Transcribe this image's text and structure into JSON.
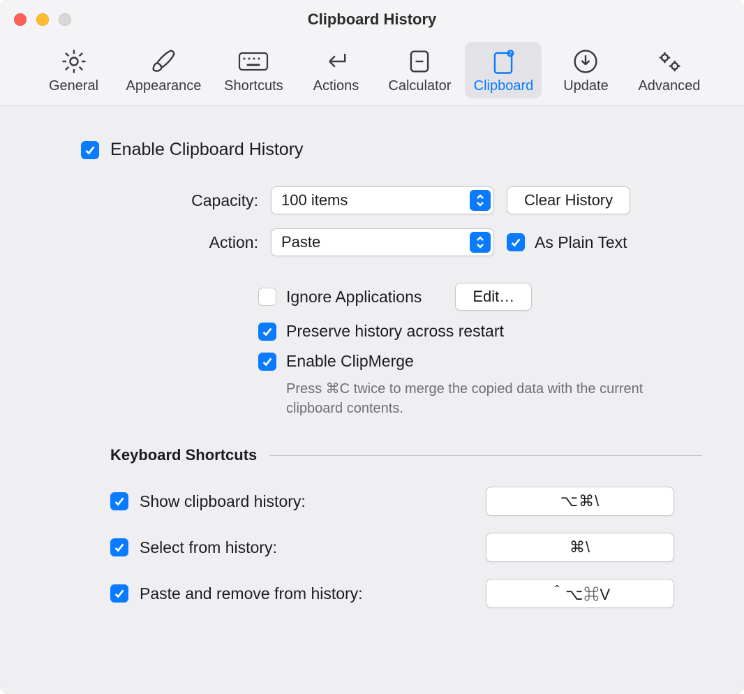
{
  "window": {
    "title": "Clipboard History"
  },
  "toolbar": {
    "items": [
      {
        "id": "general",
        "label": "General"
      },
      {
        "id": "appearance",
        "label": "Appearance"
      },
      {
        "id": "shortcuts",
        "label": "Shortcuts"
      },
      {
        "id": "actions",
        "label": "Actions"
      },
      {
        "id": "calculator",
        "label": "Calculator"
      },
      {
        "id": "clipboard",
        "label": "Clipboard",
        "selected": true
      },
      {
        "id": "update",
        "label": "Update"
      },
      {
        "id": "advanced",
        "label": "Advanced"
      }
    ]
  },
  "main": {
    "enable_label": "Enable Clipboard History",
    "enable_checked": true,
    "capacity": {
      "label": "Capacity:",
      "value": "100 items",
      "clear_button": "Clear History"
    },
    "action": {
      "label": "Action:",
      "value": "Paste",
      "plain_text_label": "As Plain Text",
      "plain_text_checked": true
    },
    "options": {
      "ignore_apps": {
        "label": "Ignore Applications",
        "checked": false,
        "edit_button": "Edit…"
      },
      "preserve": {
        "label": "Preserve history across restart",
        "checked": true
      },
      "clipmerge": {
        "label": "Enable ClipMerge",
        "checked": true,
        "hint": "Press ⌘C twice to merge the copied data with the current clipboard contents."
      }
    }
  },
  "shortcuts_section": {
    "header": "Keyboard Shortcuts",
    "rows": [
      {
        "label": "Show clipboard history:",
        "checked": true,
        "key": "⌥⌘\\"
      },
      {
        "label": "Select from history:",
        "checked": true,
        "key": "⌘\\"
      },
      {
        "label": "Paste and remove from history:",
        "checked": true,
        "key": "＾⌥⌘V"
      }
    ]
  }
}
